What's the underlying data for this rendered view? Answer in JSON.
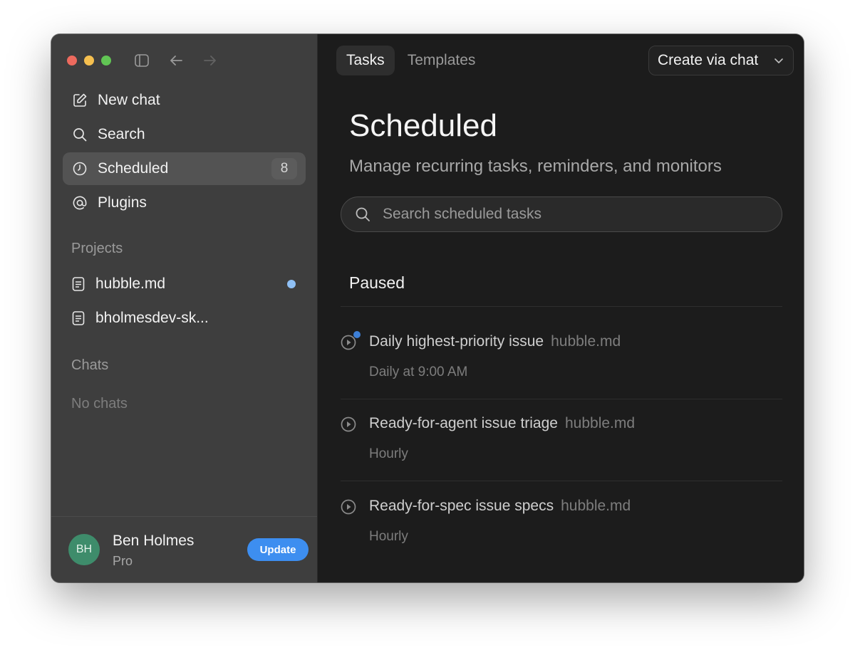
{
  "sidebar": {
    "nav": [
      {
        "label": "New chat",
        "icon": "edit-icon"
      },
      {
        "label": "Search",
        "icon": "search-icon"
      },
      {
        "label": "Scheduled",
        "icon": "clock-icon",
        "badge": "8",
        "active": true
      },
      {
        "label": "Plugins",
        "icon": "at-icon"
      }
    ],
    "projects_label": "Projects",
    "projects": [
      {
        "label": "hubble.md",
        "unread": true
      },
      {
        "label": "bholmesdev-sk..."
      }
    ],
    "chats_label": "Chats",
    "chats_empty": "No chats",
    "user": {
      "initials": "BH",
      "name": "Ben Holmes",
      "plan": "Pro",
      "avatar_color": "#3e8c6b"
    },
    "update_label": "Update"
  },
  "main": {
    "tabs": [
      {
        "label": "Tasks",
        "active": true
      },
      {
        "label": "Templates",
        "active": false
      }
    ],
    "create_label": "Create via chat",
    "title": "Scheduled",
    "subtitle": "Manage recurring tasks, reminders, and monitors",
    "search_placeholder": "Search scheduled tasks",
    "group_label": "Paused",
    "tasks": [
      {
        "name": "Daily highest-priority issue",
        "project": "hubble.md",
        "schedule": "Daily at 9:00 AM",
        "indicator": true
      },
      {
        "name": "Ready-for-agent issue triage",
        "project": "hubble.md",
        "schedule": "Hourly"
      },
      {
        "name": "Ready-for-spec issue specs",
        "project": "hubble.md",
        "schedule": "Hourly"
      }
    ]
  },
  "colors": {
    "accent": "#3d8ef0",
    "unread_dot": "#8fc0f5",
    "task_dot": "#3d7fd6"
  }
}
